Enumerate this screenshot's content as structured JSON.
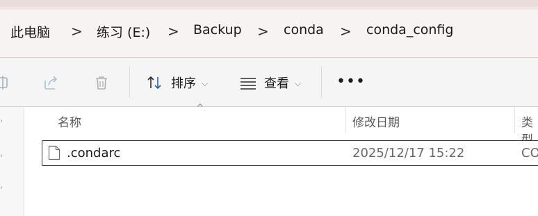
{
  "breadcrumbs": [
    "此电脑",
    "练习 (E:)",
    "Backup",
    "conda",
    "conda_config"
  ],
  "separator": ">",
  "toolbar": {
    "sort_label": "排序",
    "view_label": "查看",
    "more_label": "•••"
  },
  "columns": {
    "name": "名称",
    "modified": "修改日期",
    "type": "类型"
  },
  "files": [
    {
      "name": ".condarc",
      "modified": "2025/12/17 15:22",
      "type": "CO"
    }
  ],
  "icons": {
    "rename": "rename-icon",
    "share": "share-icon",
    "delete": "delete-icon",
    "sort": "sort-arrows-icon",
    "view": "view-lines-icon",
    "more": "more-icon",
    "file": "file-icon"
  }
}
